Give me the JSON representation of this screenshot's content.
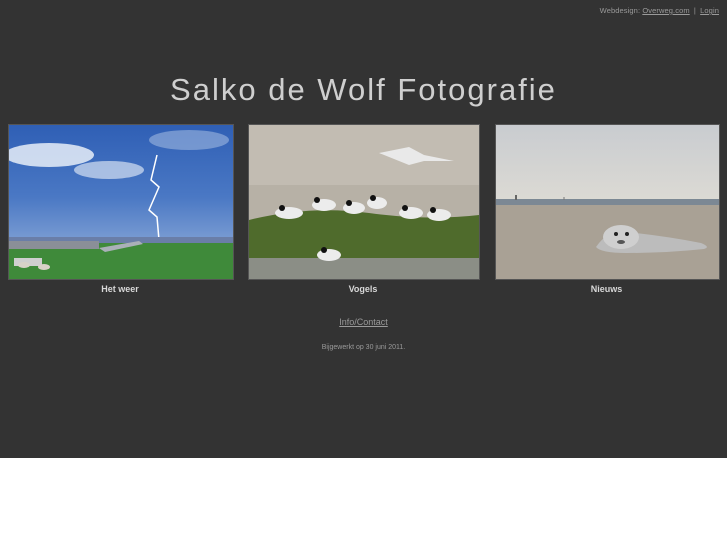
{
  "header": {
    "credit_prefix": "Webdesign:",
    "credit_link": "Overweg.com",
    "separator": "|",
    "login_link": "Login"
  },
  "site_title": "Salko de Wolf Fotografie",
  "gallery": [
    {
      "caption": "Het weer",
      "image": "lightning-landscape-photo"
    },
    {
      "caption": "Vogels",
      "image": "terns-on-grass-photo"
    },
    {
      "caption": "Nieuws",
      "image": "seal-on-beach-photo"
    }
  ],
  "info_link": "Info/Contact",
  "updated_text": "Bijgewerkt op 30 juni 2011."
}
